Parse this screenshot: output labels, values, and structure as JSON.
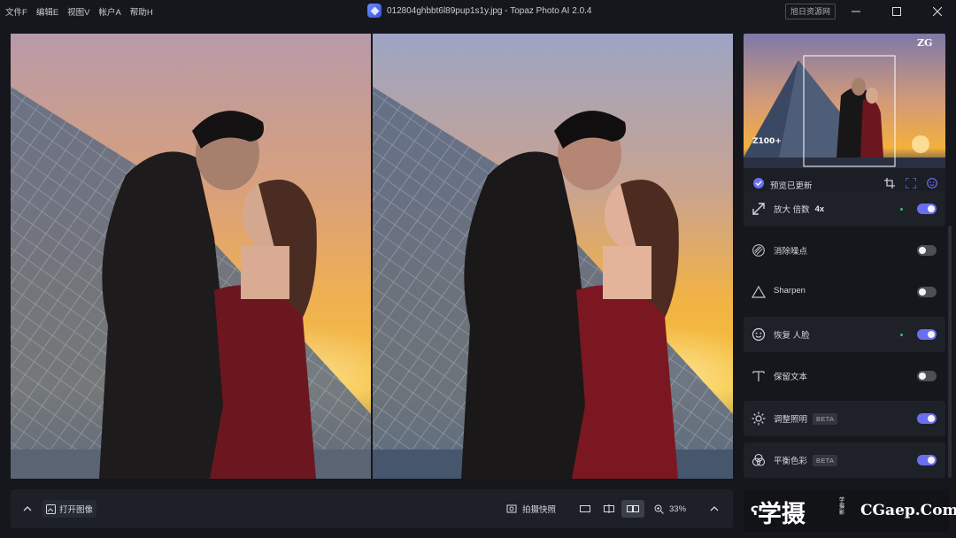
{
  "titlebar": {
    "menus": [
      "文件F",
      "编辑E",
      "视图V",
      "帐户A",
      "帮助H"
    ],
    "title": "012804ghbbt6l89pup1s1y.jpg - Topaz Photo AI 2.0.4",
    "site_badge": "旭日资源网",
    "buttons": [
      "minimize-icon",
      "maximize-icon",
      "close-icon"
    ]
  },
  "bottombar": {
    "open_image_label": "打开图像",
    "snapshot_label": "拍摄快照",
    "zoom": "33%",
    "active_view": "side-by-side"
  },
  "panel": {
    "preview_status": "预览已更新",
    "thumbnail_texts": [
      "ZG",
      "Z100+"
    ],
    "rows": [
      {
        "id": "upscale",
        "label": "放大 倍数",
        "extra": "4x",
        "icon": "resize-arrow-icon",
        "enabled": true,
        "dot": true,
        "card": true
      },
      {
        "id": "denoise",
        "label": "消除噪点",
        "icon": "noise-icon",
        "enabled": false,
        "dot": false,
        "card": false
      },
      {
        "id": "sharpen",
        "label": "Sharpen",
        "icon": "triangle-icon",
        "enabled": false,
        "dot": false,
        "card": false
      },
      {
        "id": "face",
        "label": "恢复 人脸",
        "icon": "face-icon",
        "enabled": true,
        "dot": true,
        "card": true
      },
      {
        "id": "text",
        "label": "保留文本",
        "icon": "text-icon",
        "enabled": false,
        "dot": false,
        "card": false
      },
      {
        "id": "lighting",
        "label": "调整照明",
        "badge": "BETA",
        "icon": "sun-icon",
        "enabled": true,
        "dot": false,
        "card": true
      },
      {
        "id": "color",
        "label": "平衡色彩",
        "badge": "BETA",
        "icon": "color-balance-icon",
        "enabled": true,
        "dot": false,
        "card": true
      }
    ]
  },
  "watermark": {
    "logo": "学摄",
    "small": "学摄影",
    "site": "CGaep.Com"
  },
  "colors": {
    "accent": "#6a6ff2",
    "active_dot": "#2ec46a",
    "background": "#15171c"
  }
}
